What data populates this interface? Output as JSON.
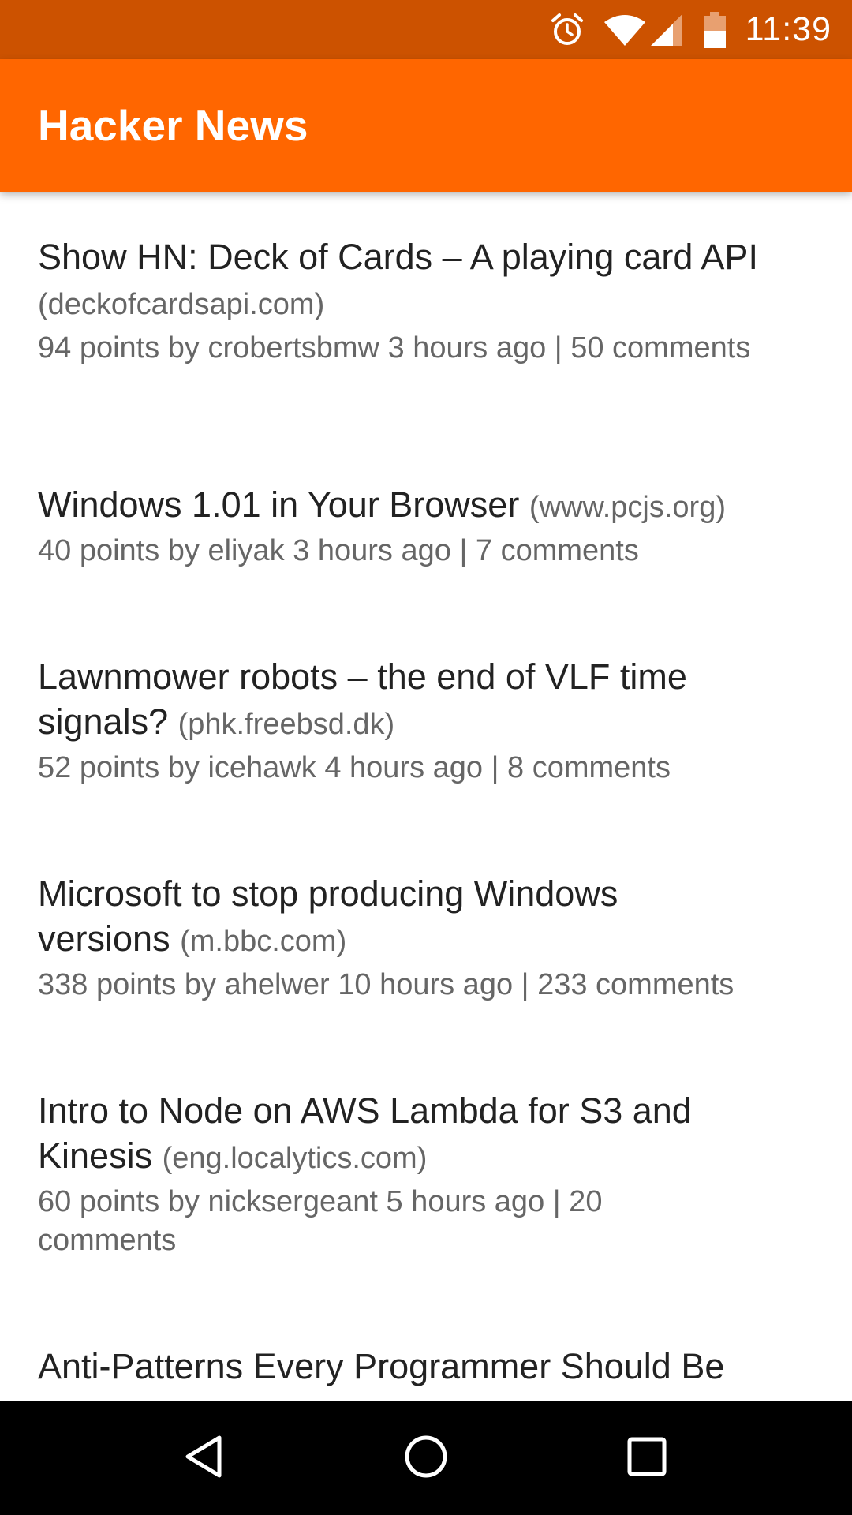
{
  "status_bar": {
    "time": "11:39",
    "icons": [
      "alarm-icon",
      "wifi-icon",
      "cell-signal-icon",
      "battery-icon"
    ]
  },
  "app_bar": {
    "title": "Hacker News",
    "color": "#ff6600"
  },
  "stories": [
    {
      "title": "Show HN: Deck of Cards – A playing card API",
      "domain": "(deckofcardsapi.com)",
      "meta": "94 points by crobertsbmw 3 hours ago | 50 comments"
    },
    {
      "title": "Windows 1.01 in Your Browser",
      "domain": "(www.pcjs.org)",
      "meta": "40 points by eliyak 3 hours ago | 7 comments"
    },
    {
      "title": "Lawnmower robots – the end of VLF time signals?",
      "domain": "(phk.freebsd.dk)",
      "meta": "52 points by icehawk 4 hours ago | 8 comments"
    },
    {
      "title": "Microsoft to stop producing Windows versions",
      "domain": "(m.bbc.com)",
      "meta": "338 points by ahelwer 10 hours ago | 233 comments"
    },
    {
      "title": "Intro to Node on AWS Lambda for S3 and Kinesis",
      "domain": "(eng.localytics.com)",
      "meta": "60 points by nicksergeant 5 hours ago | 20 comments"
    },
    {
      "title": "Anti-Patterns Every Programmer Should Be",
      "domain": "",
      "meta": ""
    }
  ],
  "nav_bar": {
    "buttons": [
      "back-icon",
      "home-icon",
      "recents-icon"
    ]
  }
}
